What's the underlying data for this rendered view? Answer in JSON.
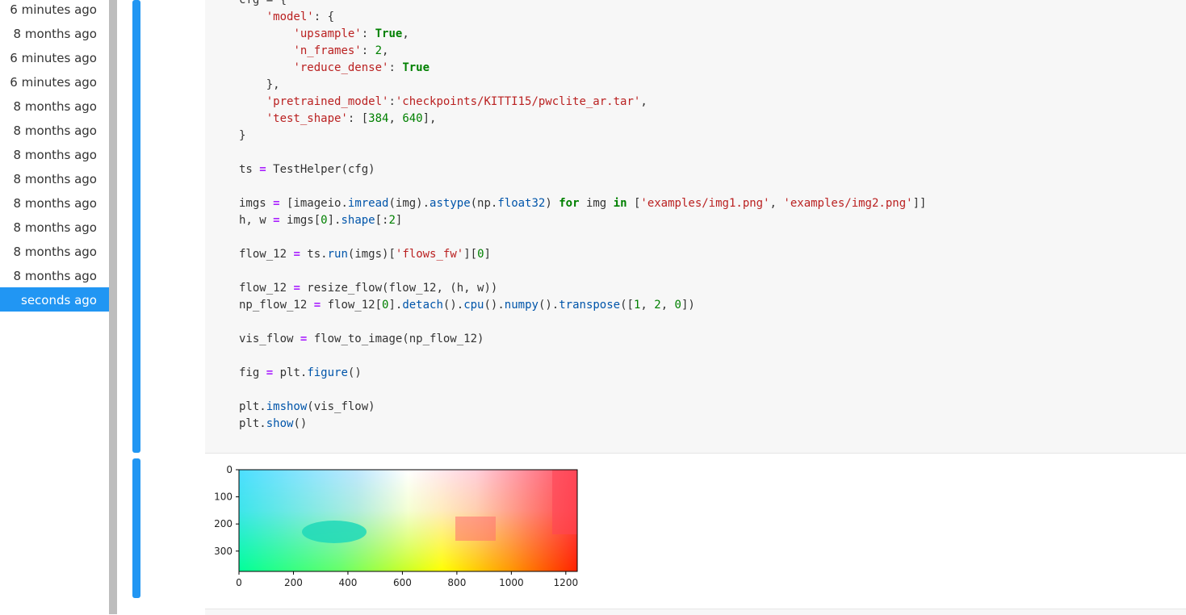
{
  "history": {
    "items": [
      {
        "label": "6 minutes ago"
      },
      {
        "label": "8 months ago"
      },
      {
        "label": "6 minutes ago"
      },
      {
        "label": "6 minutes ago"
      },
      {
        "label": "8 months ago"
      },
      {
        "label": "8 months ago"
      },
      {
        "label": "8 months ago"
      },
      {
        "label": "8 months ago"
      },
      {
        "label": "8 months ago"
      },
      {
        "label": "8 months ago"
      },
      {
        "label": "8 months ago"
      },
      {
        "label": "8 months ago"
      },
      {
        "label": "seconds ago",
        "active": true
      }
    ]
  },
  "code": {
    "lines": [
      [
        {
          "t": "cfg = {"
        }
      ],
      [
        {
          "t": "    "
        },
        {
          "t": "'model'",
          "c": "str"
        },
        {
          "t": ": {"
        }
      ],
      [
        {
          "t": "        "
        },
        {
          "t": "'upsample'",
          "c": "str"
        },
        {
          "t": ": "
        },
        {
          "t": "True",
          "c": "kw"
        },
        {
          "t": ","
        }
      ],
      [
        {
          "t": "        "
        },
        {
          "t": "'n_frames'",
          "c": "str"
        },
        {
          "t": ": "
        },
        {
          "t": "2",
          "c": "num"
        },
        {
          "t": ","
        }
      ],
      [
        {
          "t": "        "
        },
        {
          "t": "'reduce_dense'",
          "c": "str"
        },
        {
          "t": ": "
        },
        {
          "t": "True",
          "c": "kw"
        }
      ],
      [
        {
          "t": "    },"
        }
      ],
      [
        {
          "t": "    "
        },
        {
          "t": "'pretrained_model'",
          "c": "str"
        },
        {
          "t": ":"
        },
        {
          "t": "'checkpoints/KITTI15/pwclite_ar.tar'",
          "c": "str"
        },
        {
          "t": ","
        }
      ],
      [
        {
          "t": "    "
        },
        {
          "t": "'test_shape'",
          "c": "str"
        },
        {
          "t": ": ["
        },
        {
          "t": "384",
          "c": "num"
        },
        {
          "t": ", "
        },
        {
          "t": "640",
          "c": "num"
        },
        {
          "t": "],"
        }
      ],
      [
        {
          "t": "}"
        }
      ],
      [
        {
          "t": ""
        }
      ],
      [
        {
          "t": "ts "
        },
        {
          "t": "=",
          "c": "op"
        },
        {
          "t": " TestHelper(cfg)"
        }
      ],
      [
        {
          "t": ""
        }
      ],
      [
        {
          "t": "imgs "
        },
        {
          "t": "=",
          "c": "op"
        },
        {
          "t": " [imageio"
        },
        {
          "t": ".",
          "c": "fn"
        },
        {
          "t": "imread",
          "c": "attr"
        },
        {
          "t": "(img)."
        },
        {
          "t": "astype",
          "c": "attr"
        },
        {
          "t": "(np."
        },
        {
          "t": "float32",
          "c": "attr"
        },
        {
          "t": ") "
        },
        {
          "t": "for",
          "c": "kw"
        },
        {
          "t": " img "
        },
        {
          "t": "in",
          "c": "kw"
        },
        {
          "t": " ["
        },
        {
          "t": "'examples/img1.png'",
          "c": "str"
        },
        {
          "t": ", "
        },
        {
          "t": "'examples/img2.png'",
          "c": "str"
        },
        {
          "t": "]]"
        }
      ],
      [
        {
          "t": "h, w "
        },
        {
          "t": "=",
          "c": "op"
        },
        {
          "t": " imgs["
        },
        {
          "t": "0",
          "c": "num"
        },
        {
          "t": "]."
        },
        {
          "t": "shape",
          "c": "attr"
        },
        {
          "t": "[:"
        },
        {
          "t": "2",
          "c": "num"
        },
        {
          "t": "]"
        }
      ],
      [
        {
          "t": ""
        }
      ],
      [
        {
          "t": "flow_12 "
        },
        {
          "t": "=",
          "c": "op"
        },
        {
          "t": " ts."
        },
        {
          "t": "run",
          "c": "attr"
        },
        {
          "t": "(imgs)["
        },
        {
          "t": "'flows_fw'",
          "c": "str"
        },
        {
          "t": "]["
        },
        {
          "t": "0",
          "c": "num"
        },
        {
          "t": "]"
        }
      ],
      [
        {
          "t": ""
        }
      ],
      [
        {
          "t": "flow_12 "
        },
        {
          "t": "=",
          "c": "op"
        },
        {
          "t": " resize_flow(flow_12, (h, w))"
        }
      ],
      [
        {
          "t": "np_flow_12 "
        },
        {
          "t": "=",
          "c": "op"
        },
        {
          "t": " flow_12["
        },
        {
          "t": "0",
          "c": "num"
        },
        {
          "t": "]."
        },
        {
          "t": "detach",
          "c": "attr"
        },
        {
          "t": "()."
        },
        {
          "t": "cpu",
          "c": "attr"
        },
        {
          "t": "()."
        },
        {
          "t": "numpy",
          "c": "attr"
        },
        {
          "t": "()."
        },
        {
          "t": "transpose",
          "c": "attr"
        },
        {
          "t": "(["
        },
        {
          "t": "1",
          "c": "num"
        },
        {
          "t": ", "
        },
        {
          "t": "2",
          "c": "num"
        },
        {
          "t": ", "
        },
        {
          "t": "0",
          "c": "num"
        },
        {
          "t": "])"
        }
      ],
      [
        {
          "t": ""
        }
      ],
      [
        {
          "t": "vis_flow "
        },
        {
          "t": "=",
          "c": "op"
        },
        {
          "t": " flow_to_image(np_flow_12)"
        }
      ],
      [
        {
          "t": ""
        }
      ],
      [
        {
          "t": "fig "
        },
        {
          "t": "=",
          "c": "op"
        },
        {
          "t": " plt."
        },
        {
          "t": "figure",
          "c": "attr"
        },
        {
          "t": "()"
        }
      ],
      [
        {
          "t": ""
        }
      ],
      [
        {
          "t": "plt."
        },
        {
          "t": "imshow",
          "c": "attr"
        },
        {
          "t": "(vis_flow)"
        }
      ],
      [
        {
          "t": "plt."
        },
        {
          "t": "show",
          "c": "attr"
        },
        {
          "t": "()"
        }
      ]
    ]
  },
  "chart_data": {
    "type": "image",
    "title": "",
    "x_ticks": [
      "0",
      "200",
      "400",
      "600",
      "800",
      "1000",
      "1200"
    ],
    "y_ticks": [
      "0",
      "100",
      "200",
      "300"
    ],
    "xlim": [
      0,
      1242
    ],
    "ylim": [
      375,
      0
    ],
    "description_colors": [
      "#33ccff",
      "#ffffff",
      "#ff3333",
      "#00ff99",
      "#ffff00"
    ]
  }
}
